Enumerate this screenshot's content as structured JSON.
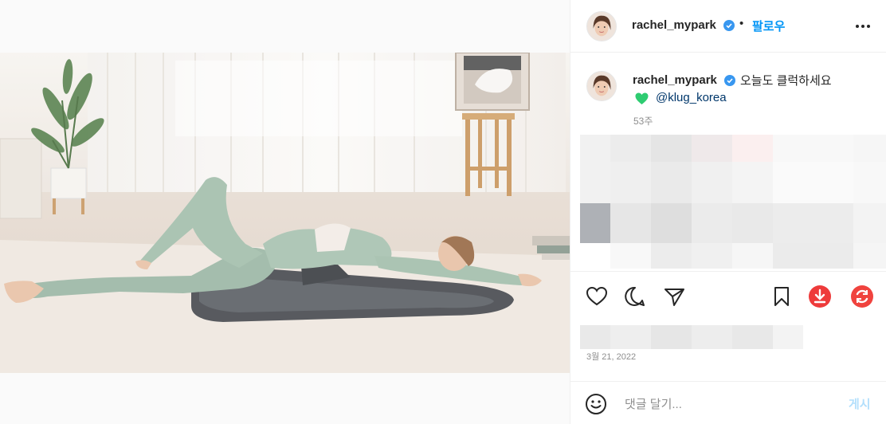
{
  "post": {
    "username": "rachel_mypark",
    "follow_label": "팔로우",
    "separator": "•",
    "caption_text": "오늘도 클럭하세요",
    "caption_mention": "@klug_korea",
    "caption_age": "53주",
    "date": "3월 21, 2022"
  },
  "comment": {
    "placeholder": "댓글 달기...",
    "post_label": "게시"
  },
  "icons": {
    "more": "more-horizontal-icon",
    "verified": "verified-badge-icon",
    "like": "heart-outline-icon",
    "comment": "comment-bubble-icon",
    "share": "paper-plane-icon",
    "save": "bookmark-icon",
    "download": "download-circle-icon",
    "refresh": "refresh-circle-icon",
    "emoji": "smiley-face-icon",
    "green_heart": "green-heart-emoji"
  },
  "colors": {
    "accent_blue": "#0095f6",
    "mention": "#00376b",
    "muted": "#8e8e8e",
    "action_red": "#ee3b3b",
    "green_heart": "#2ecc71"
  }
}
